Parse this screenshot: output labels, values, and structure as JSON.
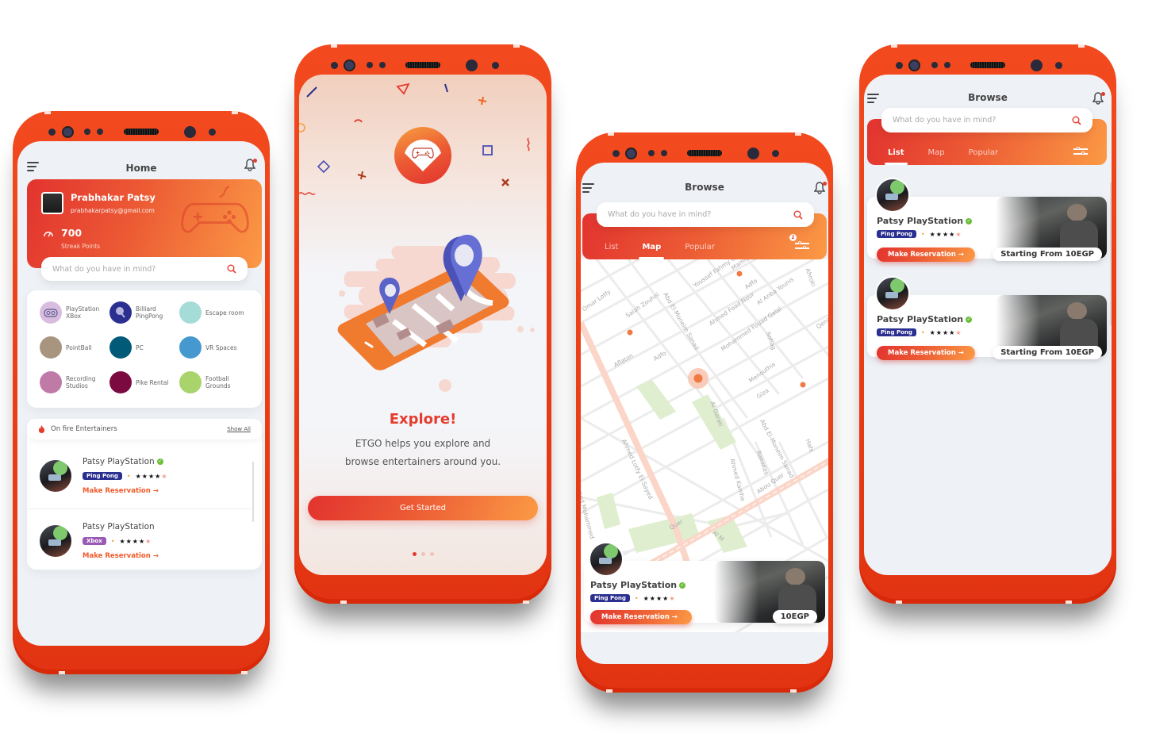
{
  "theme": {
    "accent": "#ea3e16",
    "gradient_start": "#e2332f",
    "gradient_end": "#fb9a45",
    "verified": "#6cbf3b"
  },
  "home": {
    "title": "Home",
    "profile": {
      "name": "Prabhakar Patsy",
      "email": "prabhakarpatsy@gmail.com",
      "points": "700",
      "points_label": "Streak Points"
    },
    "search_placeholder": "What do you have in mind?",
    "categories": [
      {
        "label": "PlayStation XBox",
        "color": "#d8bde0",
        "icon": "gamepad-icon"
      },
      {
        "label": "Billiard PingPong",
        "color": "#2b3090",
        "icon": "ping-pong-icon"
      },
      {
        "label": "Escape room",
        "color": "#a5dcd7"
      },
      {
        "label": "PointBall",
        "color": "#a89580"
      },
      {
        "label": "PC",
        "color": "#005a78"
      },
      {
        "label": "VR Spaces",
        "color": "#4599cf"
      },
      {
        "label": "Recording Studios",
        "color": "#bf7aa8"
      },
      {
        "label": "Pike Rental",
        "color": "#7a0a40"
      },
      {
        "label": "Football Grounds",
        "color": "#a9d46c"
      }
    ],
    "on_fire": {
      "title": "On fire Entertainers",
      "show_all": "Show All",
      "items": [
        {
          "name": "Patsy PlayStation",
          "tag": "Ping Pong",
          "tag_color": "#2b2f8f",
          "verified": true,
          "rating": "★★★★",
          "rating_extra": "★",
          "action": "Make Reservation →"
        },
        {
          "name": "Patsy PlayStation",
          "tag": "Xbox",
          "tag_color": "#9b59b6",
          "verified": false,
          "rating": "★★★★",
          "rating_extra": "★",
          "action": "Make Reservation →"
        }
      ]
    }
  },
  "onboarding": {
    "heading": "Explore!",
    "body_line1": "ETGO helps you explore and",
    "body_line2": "browse entertainers around you.",
    "cta": "Get Started",
    "page_index": 1,
    "page_count": 3
  },
  "browse_map": {
    "title": "Browse",
    "search_placeholder": "What do you have in mind?",
    "tabs": [
      "List",
      "Map",
      "Popular"
    ],
    "active_tab": "Map",
    "filter_badge": "2",
    "streets": [
      "Omar Lotfy",
      "Salah Zouhni",
      "Abd El-Moneim Sanad",
      "Youssef Fahmy Othman",
      "Adfo",
      "Ahmed Foad Nour",
      "Al Anba Younis",
      "Mohammed Fouad Galal",
      "Sohag",
      "Qena",
      "Aflaton",
      "Adfo",
      "Menouthis",
      "Giza",
      "Al Garati",
      "Ahmed Lotfy El-Sayed",
      "Ahmed Kamha",
      "Rakwtes",
      "Abd El-Moneim Sanad",
      "Hafs",
      "Abou Quer",
      "Ahmed Mohammed",
      "Mamfels",
      "Ahroki",
      "Quer",
      "Al M"
    ],
    "card": {
      "name": "Patsy PlayStation",
      "tag": "Ping Pong",
      "rating": "★★★★",
      "rating_extra": "★",
      "action": "Make Reservation →",
      "price": "10EGP"
    }
  },
  "browse_list": {
    "title": "Browse",
    "search_placeholder": "What do you have in mind?",
    "tabs": [
      "List",
      "Map",
      "Popular"
    ],
    "active_tab": "List",
    "items": [
      {
        "name": "Patsy PlayStation",
        "tag": "Ping Pong",
        "rating": "★★★★",
        "rating_extra": "★",
        "action": "Make Reservation →",
        "price": "Starting From 10EGP"
      },
      {
        "name": "Patsy PlayStation",
        "tag": "Ping Pong",
        "rating": "★★★★",
        "rating_extra": "★",
        "action": "Make Reservation →",
        "price": "Starting From 10EGP"
      }
    ]
  }
}
